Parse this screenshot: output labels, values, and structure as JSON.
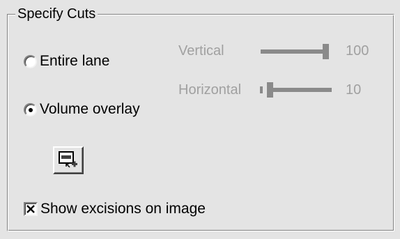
{
  "group": {
    "title": "Specify Cuts"
  },
  "radios": {
    "entire_lane": {
      "label": "Entire lane",
      "checked": false
    },
    "volume_overlay": {
      "label": "Volume overlay",
      "checked": true
    }
  },
  "sliders": {
    "vertical": {
      "label": "Vertical",
      "value": "100",
      "level": 1.0,
      "enabled": false
    },
    "horizontal": {
      "label": "Horizontal",
      "value": "10",
      "level": 0.1,
      "enabled": false
    }
  },
  "tool_button": {
    "icon": "add-cut-icon"
  },
  "checkbox": {
    "label": "Show excisions on image",
    "checked": true
  },
  "colors": {
    "disabled_text": "#a0a0a0",
    "background": "#e4e4e4"
  }
}
